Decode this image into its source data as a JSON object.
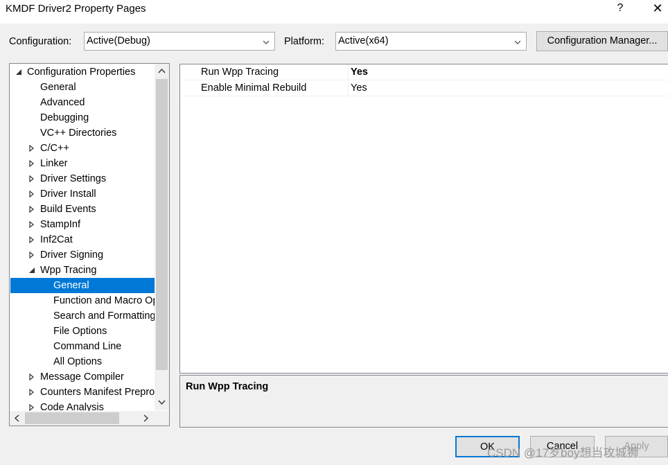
{
  "window": {
    "title": "KMDF Driver2 Property Pages",
    "help_glyph": "?",
    "close_glyph": "✕"
  },
  "toolbar": {
    "configuration_label": "Configuration:",
    "configuration_value": "Active(Debug)",
    "platform_label": "Platform:",
    "platform_value": "Active(x64)",
    "config_manager_label": "Configuration Manager..."
  },
  "tree": {
    "items": [
      {
        "label": "Configuration Properties",
        "state": "expanded"
      },
      {
        "label": "General",
        "state": "leaf"
      },
      {
        "label": "Advanced",
        "state": "leaf"
      },
      {
        "label": "Debugging",
        "state": "leaf"
      },
      {
        "label": "VC++ Directories",
        "state": "leaf"
      },
      {
        "label": "C/C++",
        "state": "collapsed"
      },
      {
        "label": "Linker",
        "state": "collapsed"
      },
      {
        "label": "Driver Settings",
        "state": "collapsed"
      },
      {
        "label": "Driver Install",
        "state": "collapsed"
      },
      {
        "label": "Build Events",
        "state": "collapsed"
      },
      {
        "label": "StampInf",
        "state": "collapsed"
      },
      {
        "label": "Inf2Cat",
        "state": "collapsed"
      },
      {
        "label": "Driver Signing",
        "state": "collapsed"
      },
      {
        "label": "Wpp Tracing",
        "state": "expanded"
      },
      {
        "label": "General",
        "state": "leaf",
        "selected": true
      },
      {
        "label": "Function and Macro Options",
        "state": "leaf"
      },
      {
        "label": "Search and Formatting",
        "state": "leaf"
      },
      {
        "label": "File Options",
        "state": "leaf"
      },
      {
        "label": "Command Line",
        "state": "leaf"
      },
      {
        "label": "All Options",
        "state": "leaf"
      },
      {
        "label": "Message Compiler",
        "state": "collapsed"
      },
      {
        "label": "Counters Manifest Preprocessor",
        "state": "collapsed"
      },
      {
        "label": "Code Analysis",
        "state": "collapsed"
      }
    ]
  },
  "grid": {
    "rows": [
      {
        "name": "Run Wpp Tracing",
        "value": "Yes",
        "bold": true
      },
      {
        "name": "Enable Minimal Rebuild",
        "value": "Yes",
        "bold": false
      }
    ]
  },
  "description": {
    "title": "Run Wpp Tracing"
  },
  "buttons": {
    "ok": "OK",
    "cancel": "Cancel",
    "apply": "Apply"
  },
  "watermark": "CSDN @17岁boy想当攻城狮",
  "colors": {
    "selection": "#0078d7",
    "window_bg": "#f0f0f0"
  }
}
